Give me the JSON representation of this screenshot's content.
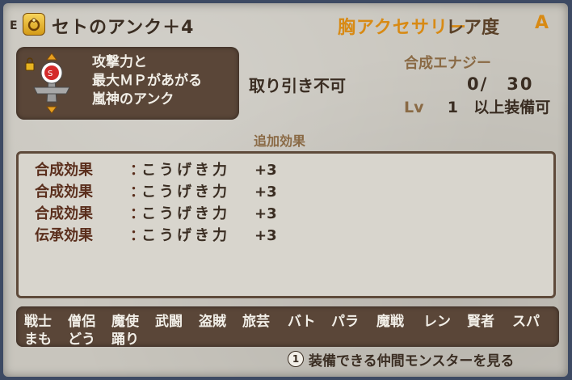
{
  "header": {
    "equip_mark": "E",
    "item_name": "セトのアンク＋4",
    "slot": "胸アクセサリー",
    "rarity_label": "レア度",
    "rarity_value": "A"
  },
  "item": {
    "description_lines": [
      "攻撃力と",
      "最大ＭＰがあがる",
      "嵐神のアンク"
    ]
  },
  "info": {
    "trade": "取り引き不可",
    "synth_label": "合成エナジー",
    "synth_count": "0/　30",
    "lv_prefix": "Lv",
    "lv_value": "1",
    "lv_suffix": "以上装備可"
  },
  "effects": {
    "heading": "追加効果",
    "rows": [
      {
        "label": "合成効果",
        "sep": "：",
        "text": "こうげき力",
        "value": "+3"
      },
      {
        "label": "合成効果",
        "sep": "：",
        "text": "こうげき力",
        "value": "+3"
      },
      {
        "label": "合成効果",
        "sep": "：",
        "text": "こうげき力",
        "value": "+3"
      },
      {
        "label": "伝承効果",
        "sep": "：",
        "text": "こうげき力",
        "value": "+3"
      }
    ]
  },
  "jobs": {
    "row1": [
      "戦士",
      "僧侶",
      "魔使",
      "武闘",
      "盗賊",
      "旅芸",
      "バト",
      "パラ",
      "魔戦",
      "レン",
      "賢者",
      "スパ"
    ],
    "row2": [
      "まも",
      "どう",
      "踊り"
    ]
  },
  "hint": {
    "button": "1",
    "text": "装備できる仲間モンスターを見る"
  },
  "colors": {
    "accent_orange": "#d88a14",
    "panel_bg": "#c8c5bd",
    "dark_box": "#5a4638"
  }
}
